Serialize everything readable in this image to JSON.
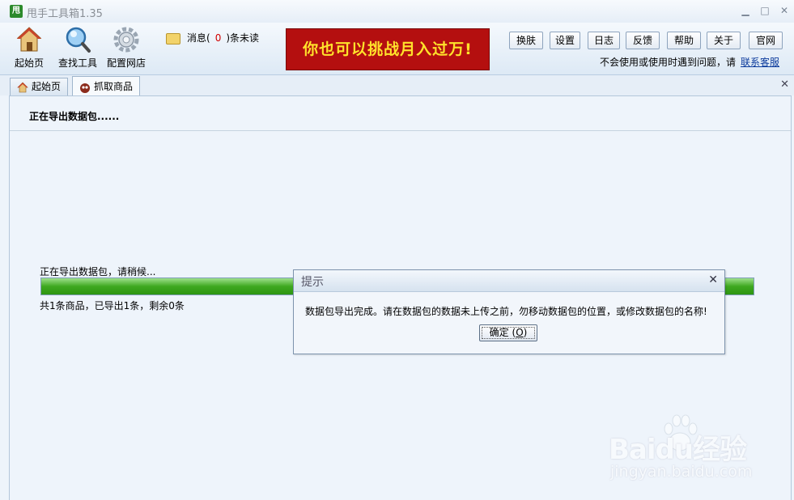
{
  "window": {
    "logo_char": "甩",
    "title": "甩手工具箱1.35",
    "minimize": "▁",
    "maximize": "□",
    "close": "✕"
  },
  "toolbar": {
    "home": "起始页",
    "find_tools": "查找工具",
    "config_store": "配置网店",
    "message_prefix": "消息(",
    "message_count": "0",
    "message_suffix": ")条未读",
    "banner": "你也可以挑战月入过万!",
    "buttons": [
      "换肤",
      "设置",
      "日志",
      "反馈",
      "帮助",
      "关于",
      "官网"
    ],
    "help_text": "不会使用或使用时遇到问题，请",
    "help_link": "联系客服"
  },
  "tabs": [
    {
      "label": "起始页"
    },
    {
      "label": "抓取商品"
    }
  ],
  "tab_close": "✕",
  "main": {
    "status": "正在导出数据包......",
    "progress_label": "正在导出数据包，请稍候...",
    "progress_fraction": 1.0,
    "progress_count": "共1条商品，已导出1条，剩余0条"
  },
  "dialog": {
    "title": "提示",
    "close": "✕",
    "message": "数据包导出完成。请在数据包的数据未上传之前，勿移动数据包的位置，或修改数据包的名称!",
    "ok_label": "确定",
    "ok_key_open": " (",
    "ok_key": "O",
    "ok_key_close": ")"
  },
  "watermark": {
    "brand": "Baidu经验",
    "url": "jingyan.baidu.com"
  },
  "colors": {
    "banner_bg": "#b40f0f",
    "banner_text": "#ffe22b",
    "progress_green": "#3ea81f",
    "link": "#0b3a9c",
    "message_count": "#d00000"
  }
}
